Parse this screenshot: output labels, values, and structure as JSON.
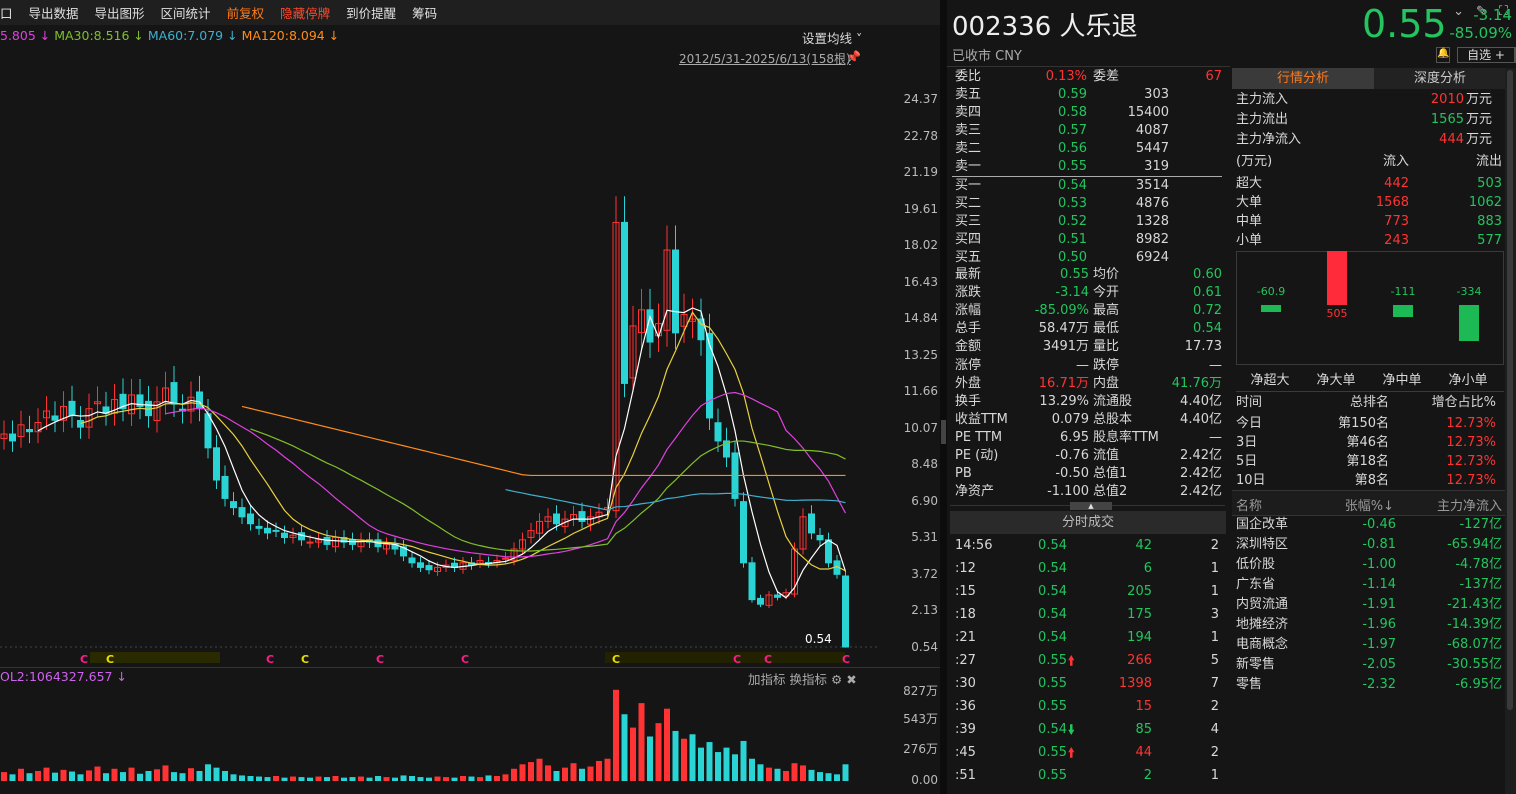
{
  "toolbar": {
    "items": [
      {
        "label": "口",
        "cls": ""
      },
      {
        "label": "导出数据",
        "cls": ""
      },
      {
        "label": "导出图形",
        "cls": ""
      },
      {
        "label": "区间统计",
        "cls": ""
      },
      {
        "label": "前复权",
        "cls": "or"
      },
      {
        "label": "隐藏停牌",
        "cls": "rd"
      },
      {
        "label": "到价提醒",
        "cls": ""
      },
      {
        "label": "筹码",
        "cls": ""
      }
    ]
  },
  "ma_legend": [
    {
      "text": "5.805 ↓",
      "color": "#e040e0"
    },
    {
      "text": "MA30:8.516 ↓",
      "color": "#7fbf2a"
    },
    {
      "text": "MA60:7.079 ↓",
      "color": "#3fb0d0"
    },
    {
      "text": "MA120:8.094 ↓",
      "color": "#ff8c1a"
    }
  ],
  "set_ma": "设置均线 ˅",
  "range_label": "2012/5/31-2025/6/13(158根)",
  "price_axis": [
    "24.37",
    "22.78",
    "21.19",
    "19.61",
    "18.02",
    "16.43",
    "14.84",
    "13.25",
    "11.66",
    "10.07",
    "8.48",
    "6.90",
    "5.31",
    "3.72",
    "2.13",
    "0.54"
  ],
  "last_price_label": "0.54",
  "vol_indicator": "OL2:1064327.657 ↓",
  "vol_buttons": {
    "add": "加指标",
    "switch": "换指标"
  },
  "vol_axis": [
    "827万",
    "543万",
    "276万",
    "0.00"
  ],
  "colors": {
    "up": "#ff3333",
    "down": "#2ad4d4",
    "green": "#22c55e",
    "accent": "#ff7a1a"
  },
  "chart_data": {
    "type": "candlestick",
    "closes": [
      9.8,
      9.5,
      10.2,
      9.9,
      10.3,
      10.8,
      10.4,
      11,
      10.6,
      10.1,
      10.9,
      11.2,
      10.7,
      11.3,
      10.9,
      11.5,
      11.0,
      10.6,
      11.2,
      11.8,
      11.1,
      10.8,
      11.4,
      10.9,
      9.2,
      7.8,
      7.0,
      6.6,
      6.2,
      5.9,
      5.7,
      5.5,
      5.6,
      5.3,
      5.4,
      5.2,
      5.1,
      5.2,
      5.0,
      5.3,
      5.1,
      5.0,
      5.2,
      5.1,
      4.9,
      5.0,
      4.8,
      4.5,
      4.2,
      4.0,
      3.9,
      4.0,
      4.1,
      4.0,
      4.2,
      4.1,
      4.3,
      4.2,
      4.3,
      4.4,
      4.8,
      5.2,
      5.6,
      6.0,
      6.2,
      5.9,
      6.1,
      6.3,
      6.0,
      6.2,
      6.4,
      6.6,
      19.0,
      12.0,
      14.5,
      15.2,
      13.8,
      14.6,
      17.8,
      14.2,
      15.0,
      14.8,
      13.9,
      10.5,
      9.5,
      8.8,
      7.0,
      4.2,
      2.6,
      2.4,
      2.8,
      2.7,
      2.9,
      4.8,
      6.2,
      5.5,
      5.2,
      4.2,
      3.7,
      0.54
    ],
    "volumes": [
      80,
      60,
      110,
      70,
      90,
      120,
      75,
      100,
      85,
      60,
      95,
      130,
      70,
      110,
      80,
      120,
      65,
      90,
      105,
      140,
      80,
      70,
      115,
      90,
      150,
      120,
      90,
      60,
      50,
      45,
      40,
      35,
      45,
      30,
      40,
      35,
      30,
      40,
      35,
      45,
      30,
      35,
      40,
      30,
      45,
      35,
      30,
      50,
      45,
      35,
      30,
      40,
      35,
      30,
      45,
      40,
      35,
      50,
      45,
      60,
      110,
      150,
      170,
      200,
      140,
      90,
      120,
      160,
      110,
      130,
      180,
      200,
      820,
      600,
      480,
      700,
      400,
      520,
      650,
      450,
      380,
      420,
      300,
      350,
      260,
      300,
      240,
      360,
      200,
      150,
      120,
      110,
      90,
      160,
      140,
      100,
      80,
      70,
      60,
      150
    ],
    "ylim": [
      0.54,
      24.37
    ]
  },
  "stock": {
    "code_name": "002336 人乐退",
    "status": "已收市 CNY",
    "price": "0.55",
    "change": "-3.14",
    "change_pct": "-85.09%",
    "watch": "自选 +",
    "bell": "bell-icon"
  },
  "orderbook": {
    "wb_label": "委比",
    "wb": "0.13%",
    "wc_label": "委差",
    "wc": "67",
    "asks": [
      [
        "卖五",
        "0.59",
        "303"
      ],
      [
        "卖四",
        "0.58",
        "15400"
      ],
      [
        "卖三",
        "0.57",
        "4087"
      ],
      [
        "卖二",
        "0.56",
        "5447"
      ],
      [
        "卖一",
        "0.55",
        "319"
      ]
    ],
    "bids": [
      [
        "买一",
        "0.54",
        "3514"
      ],
      [
        "买二",
        "0.53",
        "4876"
      ],
      [
        "买三",
        "0.52",
        "1328"
      ],
      [
        "买四",
        "0.51",
        "8982"
      ],
      [
        "买五",
        "0.50",
        "6924"
      ]
    ]
  },
  "stats": [
    [
      "最新",
      "0.55",
      "g",
      "均价",
      "0.60",
      "g"
    ],
    [
      "涨跌",
      "-3.14",
      "g",
      "今开",
      "0.61",
      "g"
    ],
    [
      "涨幅",
      "-85.09%",
      "g",
      "最高",
      "0.72",
      "g"
    ],
    [
      "总手",
      "58.47万",
      "w",
      "最低",
      "0.54",
      "g"
    ],
    [
      "金额",
      "3491万",
      "w",
      "量比",
      "17.73",
      "w"
    ],
    [
      "涨停",
      "—",
      "w",
      "跌停",
      "—",
      "w"
    ],
    [
      "外盘",
      "16.71万",
      "r",
      "内盘",
      "41.76万",
      "g"
    ],
    [
      "换手",
      "13.29%",
      "w",
      "流通股",
      "4.40亿",
      "w"
    ],
    [
      "收益TTM",
      "0.079",
      "w",
      "总股本",
      "4.40亿",
      "w"
    ],
    [
      "PE TTM",
      "6.95",
      "w",
      "股息率TTM",
      "—",
      "w"
    ],
    [
      "PE (动)",
      "-0.76",
      "w",
      "流值",
      "2.42亿",
      "w"
    ],
    [
      "PB",
      "-0.50",
      "w",
      "总值1",
      "2.42亿",
      "w"
    ],
    [
      "净资产",
      "-1.100",
      "w",
      "总值2",
      "2.42亿",
      "w"
    ]
  ],
  "trades_title": "分时成交",
  "trades": [
    [
      "14:56",
      "0.54",
      "g",
      "42",
      "g",
      "2",
      ""
    ],
    [
      ":12",
      "0.54",
      "g",
      "6",
      "g",
      "1",
      ""
    ],
    [
      ":15",
      "0.54",
      "g",
      "205",
      "g",
      "1",
      ""
    ],
    [
      ":18",
      "0.54",
      "g",
      "175",
      "g",
      "3",
      ""
    ],
    [
      ":21",
      "0.54",
      "g",
      "194",
      "g",
      "1",
      ""
    ],
    [
      ":27",
      "0.55",
      "g",
      "266",
      "r",
      "5",
      "up"
    ],
    [
      ":30",
      "0.55",
      "g",
      "1398",
      "r",
      "7",
      ""
    ],
    [
      ":36",
      "0.55",
      "g",
      "15",
      "r",
      "2",
      ""
    ],
    [
      ":39",
      "0.54",
      "g",
      "85",
      "g",
      "4",
      "down"
    ],
    [
      ":45",
      "0.55",
      "g",
      "44",
      "r",
      "2",
      "up"
    ],
    [
      ":51",
      "0.55",
      "g",
      "2",
      "g",
      "1",
      ""
    ]
  ],
  "analysis": {
    "tabs": [
      "行情分析",
      "深度分析"
    ],
    "flows": [
      [
        "主力流入",
        "2010",
        "万元"
      ],
      [
        "主力流出",
        "1565",
        "万元"
      ],
      [
        "主力净流入",
        "444",
        "万元"
      ]
    ],
    "table_head": [
      "(万元)",
      "流入",
      "流出"
    ],
    "table": [
      [
        "超大",
        "442",
        "503"
      ],
      [
        "大单",
        "1568",
        "1062"
      ],
      [
        "中单",
        "773",
        "883"
      ],
      [
        "小单",
        "243",
        "577"
      ]
    ],
    "net_bars": [
      {
        "label": "净超大",
        "value": -60.9
      },
      {
        "label": "净大单",
        "value": 505
      },
      {
        "label": "净中单",
        "value": -111
      },
      {
        "label": "净小单",
        "value": -334
      }
    ],
    "rank_head": [
      "时间",
      "总排名",
      "增仓占比%"
    ],
    "rank": [
      [
        "今日",
        "第150名",
        "12.73%"
      ],
      [
        "3日",
        "第46名",
        "12.73%"
      ],
      [
        "5日",
        "第18名",
        "12.73%"
      ],
      [
        "10日",
        "第8名",
        "12.73%"
      ]
    ],
    "sector_head": [
      "名称",
      "张幅%↓",
      "主力净流入"
    ],
    "sectors": [
      [
        "国企改革",
        "-0.46",
        "-127亿"
      ],
      [
        "深圳特区",
        "-0.81",
        "-65.94亿"
      ],
      [
        "低价股",
        "-1.00",
        "-4.78亿"
      ],
      [
        "广东省",
        "-1.14",
        "-137亿"
      ],
      [
        "内贸流通",
        "-1.91",
        "-21.43亿"
      ],
      [
        "地摊经济",
        "-1.96",
        "-14.39亿"
      ],
      [
        "电商概念",
        "-1.97",
        "-68.07亿"
      ],
      [
        "新零售",
        "-2.05",
        "-30.55亿"
      ],
      [
        "零售",
        "-2.32",
        "-6.95亿"
      ]
    ]
  }
}
